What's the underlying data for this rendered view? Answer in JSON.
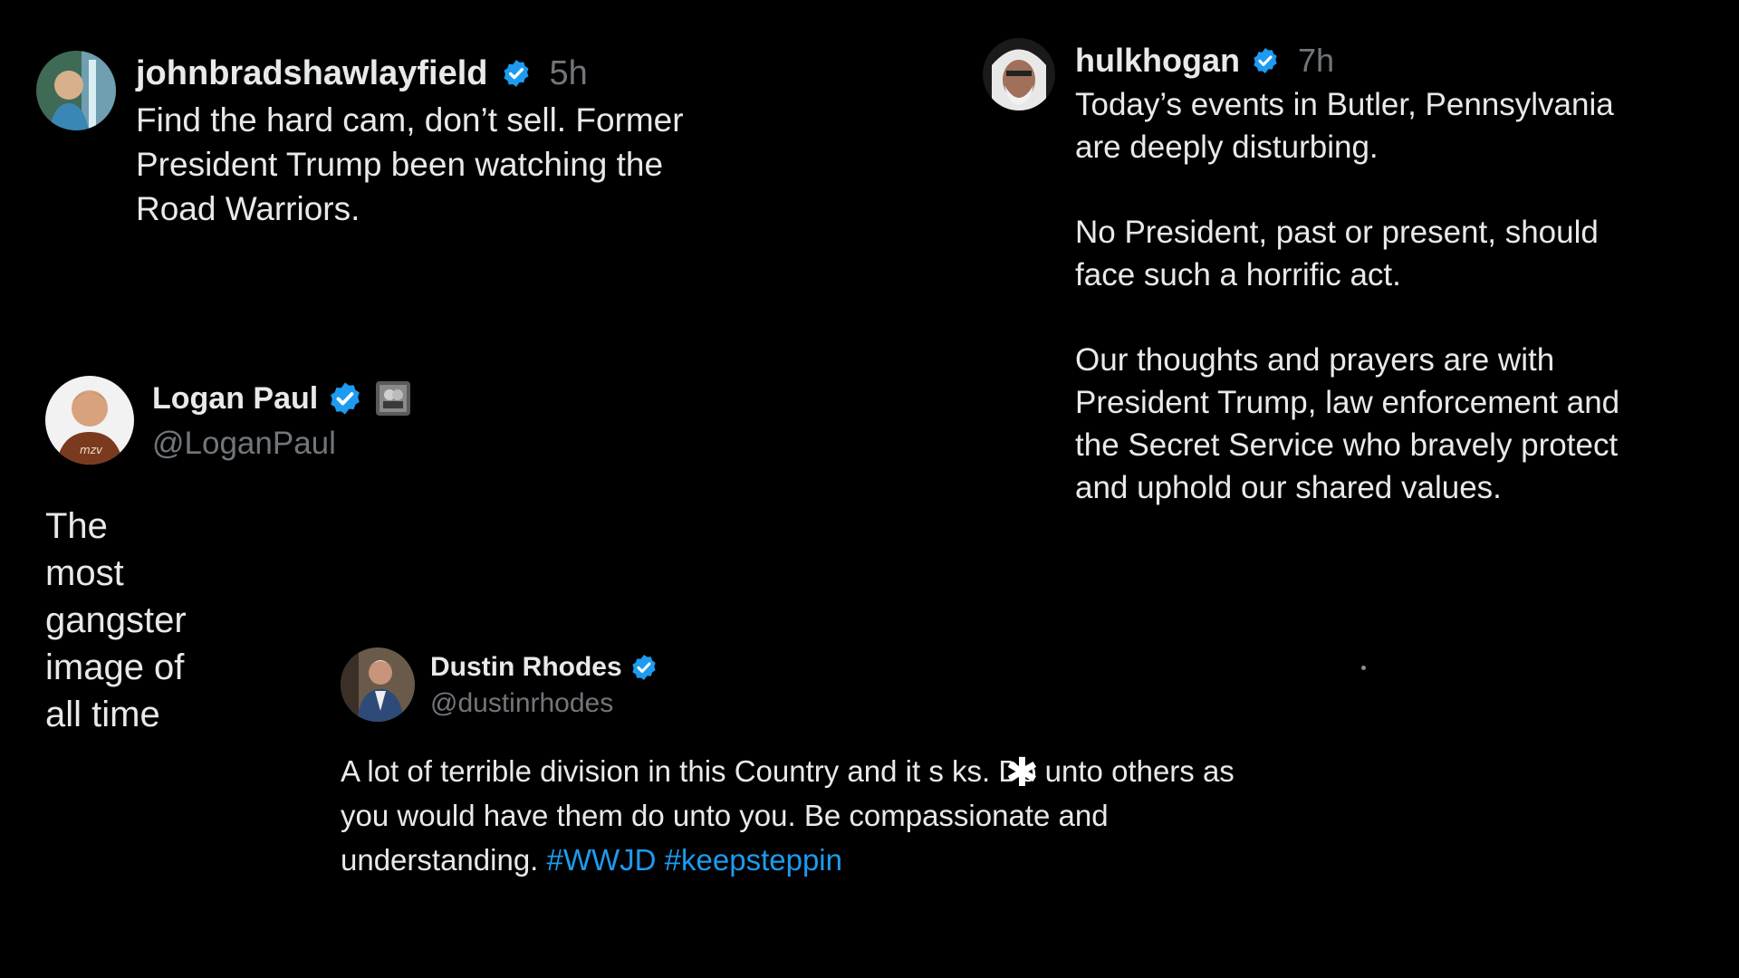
{
  "posts": [
    {
      "username": "johnbradshawlayfield",
      "verified": true,
      "time": "5h",
      "text": "Find the hard cam, don’t sell. Former\nPresident Trump been watching the\nRoad Warriors."
    },
    {
      "username": "hulkhogan",
      "verified": true,
      "time": "7h",
      "text": "Today’s events in Butler, Pennsylvania\nare deeply disturbing.\n\nNo President, past or present, should\nface such a horrific act.\n\nOur thoughts and prayers are with\nPresident Trump, law enforcement and\nthe Secret Service who bravely protect\nand uphold our shared values."
    },
    {
      "display_name": "Logan Paul",
      "verified": true,
      "handle": "@LoganPaul",
      "text": "The most gangster image of all time"
    },
    {
      "display_name": "Dustin Rhodes",
      "verified": true,
      "handle": "@dustinrhodes",
      "text": "A lot of terrible division in this Country and it s  ks. Do unto others as\nyou would have them do unto you. Be compassionate and\nunderstanding. ",
      "hashtags": "#WWJD #keepsteppin"
    }
  ],
  "colors": {
    "background": "#000000",
    "text": "#e7e9ea",
    "secondary": "#71767b",
    "verified": "#1d9bf0",
    "hashtag": "#1d9bf0"
  },
  "icons": {
    "verified": "verified-badge-icon",
    "cursor": "asterisk-cursor-icon"
  }
}
